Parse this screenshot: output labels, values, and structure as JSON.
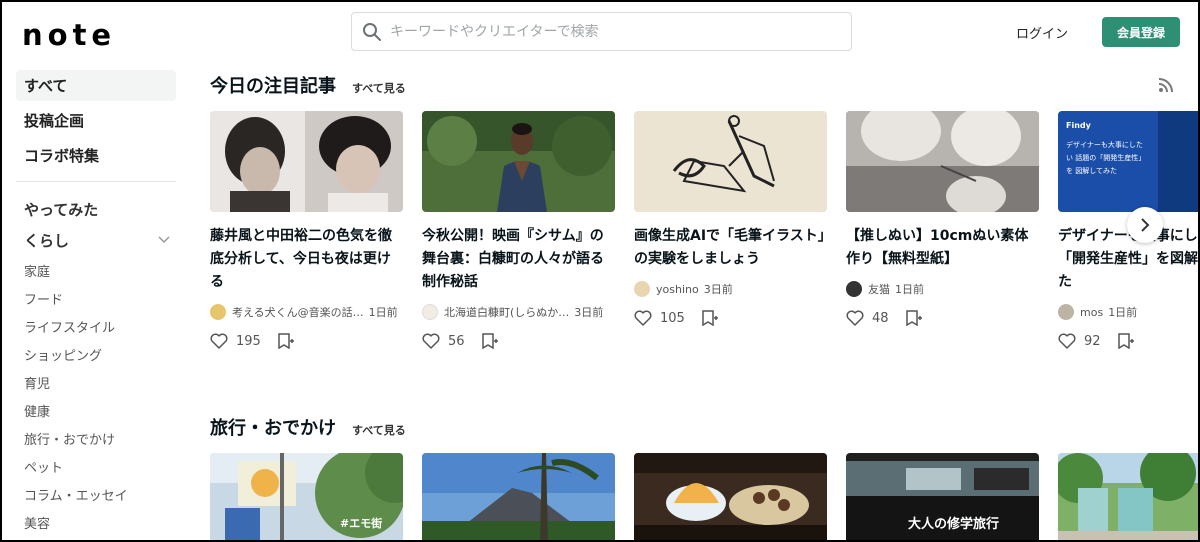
{
  "header": {
    "logo": "note",
    "search_placeholder": "キーワードやクリエイターで検索",
    "login_label": "ログイン",
    "signup_label": "会員登録"
  },
  "sidebar": {
    "main": [
      {
        "label": "すべて",
        "active": true
      },
      {
        "label": "投稿企画"
      },
      {
        "label": "コラボ特集"
      }
    ],
    "categories": [
      {
        "label": "やってみた"
      },
      {
        "label": "くらし",
        "expandable": true
      }
    ],
    "subitems": [
      "家庭",
      "フード",
      "ライフスタイル",
      "ショッピング",
      "育児",
      "健康",
      "旅行・おでかけ",
      "ペット",
      "コラム・エッセイ",
      "美容"
    ]
  },
  "sections": [
    {
      "title": "今日の注目記事",
      "more": "すべて見る",
      "cards": [
        {
          "title": "藤井風と中田裕二の色気を徹底分析して、今日も夜は更ける",
          "author": "考える犬くん@音楽の話…",
          "time": "1日前",
          "likes": "195"
        },
        {
          "title": "今秋公開！映画『シサム』の舞台裏：白糠町の人々が語る制作秘話",
          "author": "北海道白糠町(しらぬか…",
          "time": "3日前",
          "likes": "56"
        },
        {
          "title": "画像生成AIで「毛筆イラスト」の実験をしましょう",
          "author": "yoshino",
          "time": "3日前",
          "likes": "105"
        },
        {
          "title": "【推しぬい】10cmぬい素体作り【無料型紙】",
          "author": "友猫",
          "time": "1日前",
          "likes": "48"
        },
        {
          "title": "デザイナーも大事にしたい「開発生産性」を図解してみた",
          "author": "mos",
          "time": "1日前",
          "likes": "92",
          "thumb_brand": "Findy",
          "thumb_text": "デザイナーも大事にしたい 話題の「開発生産性」を 図解してみた"
        }
      ]
    },
    {
      "title": "旅行・おでかけ",
      "more": "すべて見る",
      "thumb_text_1": "#エモ街",
      "thumb_text_4": "大人の修学旅行"
    }
  ],
  "icons": {
    "search": "search-icon",
    "rss": "rss-icon",
    "heart": "heart-icon",
    "magazine": "magazine-add-icon",
    "next": "chevron-right-icon",
    "expand": "chevron-down-icon"
  },
  "colors": {
    "accent": "#2d8f73",
    "text": "#08131a",
    "sidebar_active_bg": "#f3f5f5"
  }
}
